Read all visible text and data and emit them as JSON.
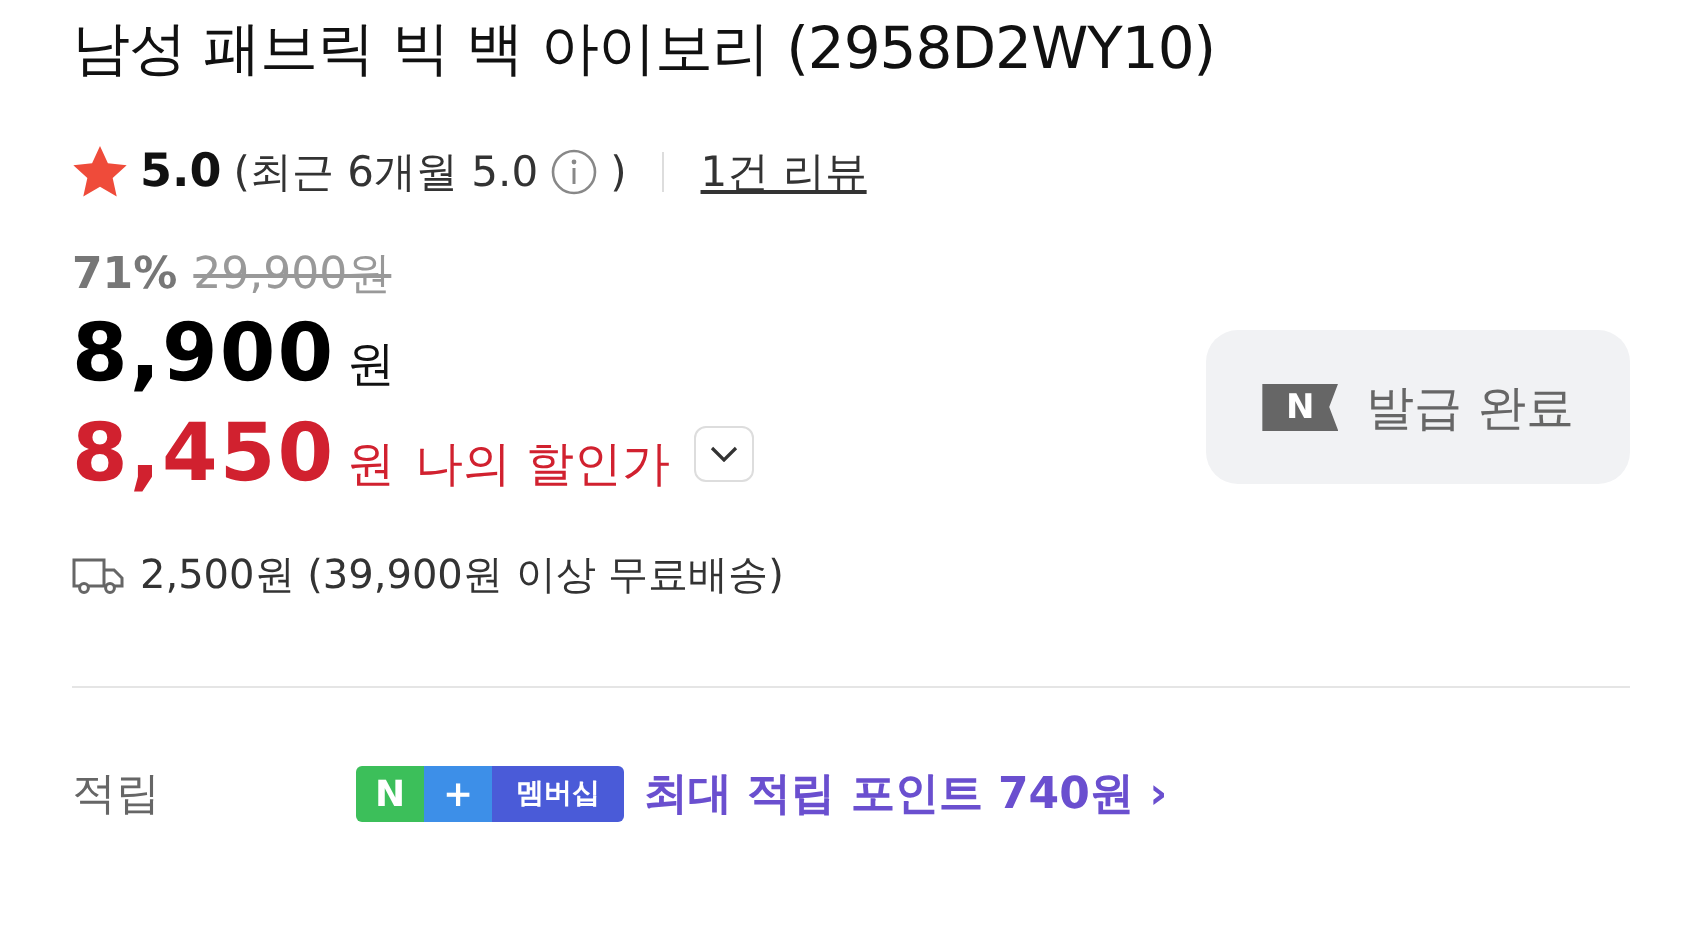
{
  "title": "남성 패브릭 빅 백 아이보리 (2958D2WY10)",
  "rating": {
    "score": "5.0",
    "recent": "(최근 6개월 5.0",
    "close": ")",
    "reviews": "1건 리뷰"
  },
  "price": {
    "discount": "71%",
    "original": "29,900원",
    "sale": "8,900",
    "sale_unit": "원",
    "my_price": "8,450",
    "my_unit": "원",
    "my_label": "나의 할인가",
    "expanded": false
  },
  "coupon_button": {
    "label": "발급 완료",
    "badge": "N",
    "disabled": true
  },
  "shipping": "2,500원 (39,900원 이상 무료배송)",
  "points": {
    "label": "적립",
    "badge_n": "N",
    "badge_plus": "+",
    "badge_text": "멤버십",
    "text": "최대 적립 포인트 740원",
    "arrow": "›"
  }
}
